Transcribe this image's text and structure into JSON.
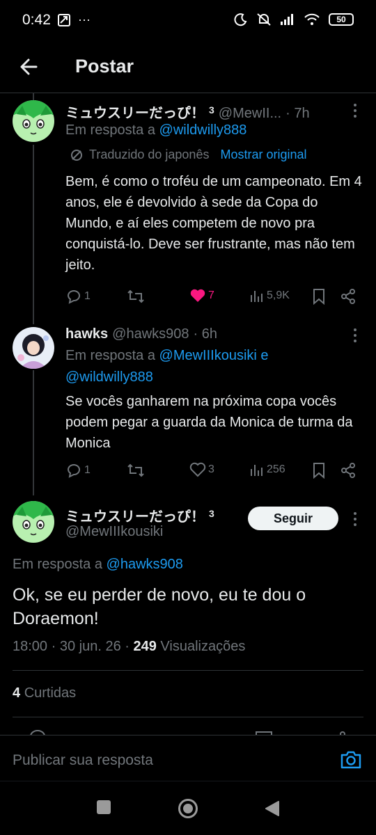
{
  "status_bar": {
    "time": "0:42",
    "battery": "50"
  },
  "header": {
    "title": "Postar"
  },
  "tweets": [
    {
      "name": "ミュウスリーだっぴ！",
      "badge": "3",
      "handle": "@MewII...",
      "time": "· 7h",
      "reply_prefix": "Em resposta a",
      "reply_to": "@wildwilly888",
      "translated_label": "Traduzido do japonês",
      "show_original": "Mostrar original",
      "text": "Bem, é como o troféu de um campeonato. Em 4 anos, ele é devolvido à sede da Copa do Mundo, e aí eles competem de novo pra conquistá-lo. Deve ser frustrante, mas não tem jeito.",
      "replies": "1",
      "likes": "7",
      "views": "5,9K"
    },
    {
      "name": "hawks",
      "handle": "@hawks908",
      "time": "· 6h",
      "reply_prefix": "Em resposta a",
      "reply_to": "@MewIIIkousiki",
      "reply_and": "e",
      "reply_to_2": "@wildwilly888",
      "text": "Se vocês ganharem na próxima copa vocês podem pegar a guarda da Monica de turma da Monica",
      "replies": "1",
      "likes": "3",
      "views": "256"
    }
  ],
  "main_tweet": {
    "name": "ミュウスリーだっぴ！",
    "badge": "3",
    "handle": "@MewIIIkousiki",
    "follow_label": "Seguir",
    "reply_prefix": "Em resposta a",
    "reply_to": "@hawks908",
    "text": "Ok, se eu perder de novo, eu te dou o Doraemon!",
    "time": "18:00",
    "date": "· 30 jun. 26 ·",
    "views_count": "249",
    "views_label": "Visualizações",
    "likes_count": "4",
    "likes_label": "Curtidas"
  },
  "reply_bar": {
    "placeholder": "Publicar sua resposta"
  },
  "colors": {
    "accent": "#1d9bf0",
    "like": "#f91880",
    "muted": "#71767b",
    "text": "#e7e9ea"
  }
}
